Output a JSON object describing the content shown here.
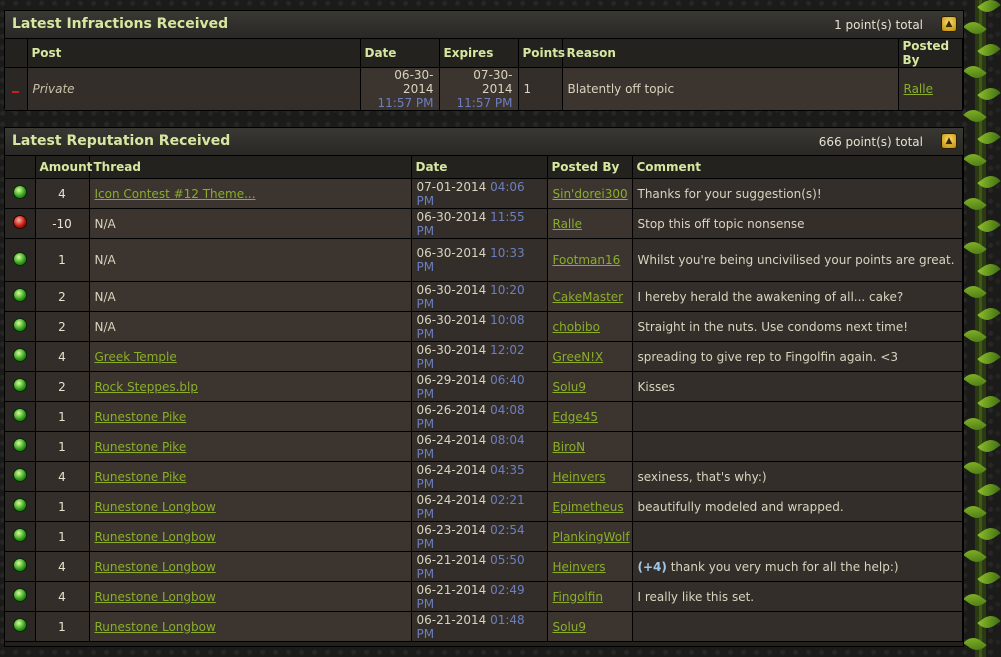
{
  "infractions": {
    "title": "Latest Infractions Received",
    "total": "1 point(s) total",
    "headers": [
      "Post",
      "Date",
      "Expires",
      "Points",
      "Reason",
      "Posted By"
    ],
    "row": {
      "post": "Private",
      "date": "06-30-2014",
      "date_time": "11:57 PM",
      "expires": "07-30-2014",
      "expires_time": "11:57 PM",
      "points": "1",
      "reason": "Blatently off topic",
      "posted_by": "Ralle"
    }
  },
  "reputation": {
    "title": "Latest Reputation Received",
    "total": "666 point(s) total",
    "headers": [
      "Amount",
      "Thread",
      "Date",
      "Posted By",
      "Comment"
    ],
    "rows": [
      {
        "status": "green",
        "amount": "4",
        "thread": "Icon Contest #12 Theme...",
        "thread_link": true,
        "date": "07-01-2014",
        "time": "04:06 PM",
        "user": "Sin'dorei300",
        "comment": "Thanks for your suggestion(s)!"
      },
      {
        "status": "red",
        "amount": "-10",
        "thread": "N/A",
        "thread_link": false,
        "date": "06-30-2014",
        "time": "11:55 PM",
        "user": "Ralle",
        "comment": "Stop this off topic nonsense"
      },
      {
        "status": "green",
        "amount": "1",
        "thread": "N/A",
        "thread_link": false,
        "date": "06-30-2014",
        "time": "10:33 PM",
        "user": "Footman16",
        "comment": "Whilst you're being uncivilised your points are great."
      },
      {
        "status": "green",
        "amount": "2",
        "thread": "N/A",
        "thread_link": false,
        "date": "06-30-2014",
        "time": "10:20 PM",
        "user": "CakeMaster",
        "comment": "I hereby herald the awakening of all... cake?"
      },
      {
        "status": "green",
        "amount": "2",
        "thread": "N/A",
        "thread_link": false,
        "date": "06-30-2014",
        "time": "10:08 PM",
        "user": "chobibo",
        "comment": "Straight in the nuts. Use condoms next time!"
      },
      {
        "status": "green",
        "amount": "4",
        "thread": "Greek Temple",
        "thread_link": true,
        "date": "06-30-2014",
        "time": "12:02 PM",
        "user": "GreeN!X",
        "comment": "spreading to give rep to Fingolfin again. <3"
      },
      {
        "status": "green",
        "amount": "2",
        "thread": "Rock Steppes.blp",
        "thread_link": true,
        "date": "06-29-2014",
        "time": "06:40 PM",
        "user": "Solu9",
        "comment": "Kisses"
      },
      {
        "status": "green",
        "amount": "1",
        "thread": "Runestone Pike",
        "thread_link": true,
        "date": "06-26-2014",
        "time": "04:08 PM",
        "user": "Edge45",
        "comment": ""
      },
      {
        "status": "green",
        "amount": "1",
        "thread": "Runestone Pike",
        "thread_link": true,
        "date": "06-24-2014",
        "time": "08:04 PM",
        "user": "BiroN",
        "comment": ""
      },
      {
        "status": "green",
        "amount": "4",
        "thread": "Runestone Pike",
        "thread_link": true,
        "date": "06-24-2014",
        "time": "04:35 PM",
        "user": "Heinvers",
        "comment": "sexiness, that's why:)"
      },
      {
        "status": "green",
        "amount": "1",
        "thread": "Runestone Longbow",
        "thread_link": true,
        "date": "06-24-2014",
        "time": "02:21 PM",
        "user": "Epimetheus",
        "comment": "beautifully modeled and wrapped."
      },
      {
        "status": "green",
        "amount": "1",
        "thread": "Runestone Longbow",
        "thread_link": true,
        "date": "06-23-2014",
        "time": "02:54 PM",
        "user": "PlankingWolf",
        "comment": ""
      },
      {
        "status": "green",
        "amount": "4",
        "thread": "Runestone Longbow",
        "thread_link": true,
        "date": "06-21-2014",
        "time": "05:50 PM",
        "user": "Heinvers",
        "comment_prefix": "(+4)",
        "comment": "thank you very much for all the help:)"
      },
      {
        "status": "green",
        "amount": "4",
        "thread": "Runestone Longbow",
        "thread_link": true,
        "date": "06-21-2014",
        "time": "02:49 PM",
        "user": "Fingolfin",
        "comment": "I really like this set."
      },
      {
        "status": "green",
        "amount": "1",
        "thread": "Runestone Longbow",
        "thread_link": true,
        "date": "06-21-2014",
        "time": "01:48 PM",
        "user": "Solu9",
        "comment": ""
      }
    ]
  },
  "icons": {
    "collapse": "collapse-up-arrow-icon",
    "positive": "green-reputation-orb-icon",
    "negative": "red-reputation-orb-icon",
    "infraction": "infraction-minus-icon"
  }
}
